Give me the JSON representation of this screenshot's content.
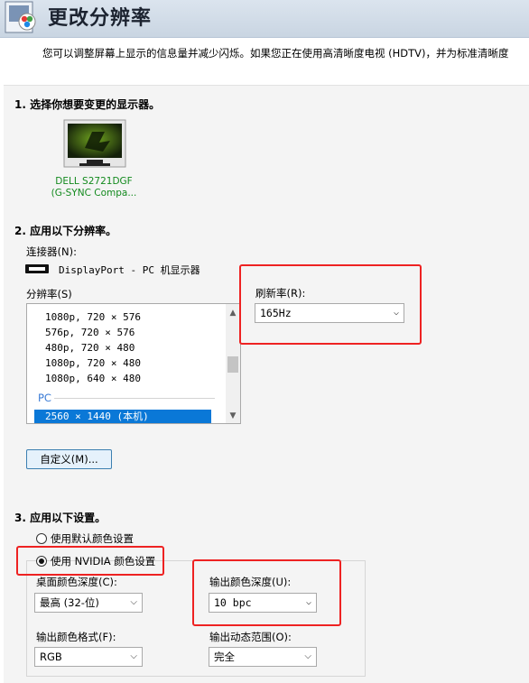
{
  "header": {
    "title": "更改分辨率"
  },
  "description": "您可以调整屏幕上显示的信息量并减少闪烁。如果您正在使用高清晰度电视 (HDTV)，并为标准清晰度",
  "section1": {
    "title": "1. 选择你想要变更的显示器。",
    "monitor_line1": "DELL S2721DGF",
    "monitor_line2": "(G-SYNC Compa..."
  },
  "section2": {
    "title": "2. 应用以下分辨率。",
    "connector_label": "连接器(N):",
    "connector_value": "DisplayPort - PC 机显示器",
    "resolution_label": "分辨率(S)",
    "resolutions": [
      "1080p, 720 × 576",
      "576p, 720 × 576",
      "480p, 720 × 480",
      "1080p, 720 × 480",
      "1080p, 640 × 480"
    ],
    "group_pc": "PC",
    "selected_resolution": "2560 × 1440 (本机)",
    "refresh_label": "刷新率(R):",
    "refresh_value": "165Hz",
    "custom_button": "自定义(M)..."
  },
  "section3": {
    "title": "3. 应用以下设置。",
    "radio_default": "使用默认颜色设置",
    "radio_nvidia": "使用 NVIDIA 颜色设置",
    "desktop_depth_label": "桌面颜色深度(C):",
    "desktop_depth_value": "最高 (32-位)",
    "output_depth_label": "输出颜色深度(U):",
    "output_depth_value": "10 bpc",
    "output_format_label": "输出颜色格式(F):",
    "output_format_value": "RGB",
    "dynamic_range_label": "输出动态范围(O):",
    "dynamic_range_value": "完全"
  },
  "colors": {
    "annotation": "#ee2222",
    "selection": "#0a78d7",
    "monitor_label": "#138a1e",
    "group_header": "#3a7bd5"
  }
}
